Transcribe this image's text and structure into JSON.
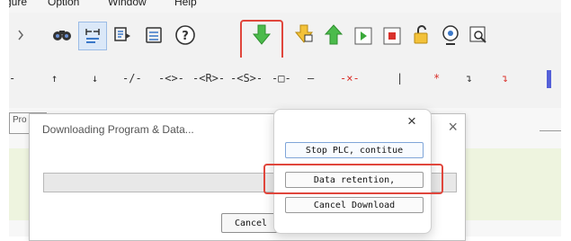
{
  "menubar": {
    "items": [
      "gure",
      "Option",
      "Window",
      "Help"
    ]
  },
  "toolbar": {
    "icons": [
      "find-icon",
      "ladder-comment-icon",
      "dialog-icon",
      "print-preview-icon",
      "help-icon",
      "download-icon",
      "upload-lock-icon",
      "upload-icon",
      "run-icon",
      "stop-icon",
      "unlock-icon",
      "monitor-icon",
      "overview-icon"
    ],
    "accent": "#e0463c"
  },
  "ladder_symbols": [
    "-",
    "↑",
    "↓",
    "-/-",
    "-<>-",
    "-<R>-",
    "-<S>-",
    "-□-",
    "—",
    "-×-",
    "|",
    "*",
    "↴",
    "↴"
  ],
  "left_tab": {
    "label": "Pro"
  },
  "dialog": {
    "title": "Downloading Program & Data...",
    "close": "×",
    "progress_percent": 0,
    "cancel_label": "Cancel"
  },
  "popup": {
    "close": "×",
    "buttons": [
      "Stop PLC, contitue",
      "Data retention,",
      "Cancel Download"
    ]
  }
}
